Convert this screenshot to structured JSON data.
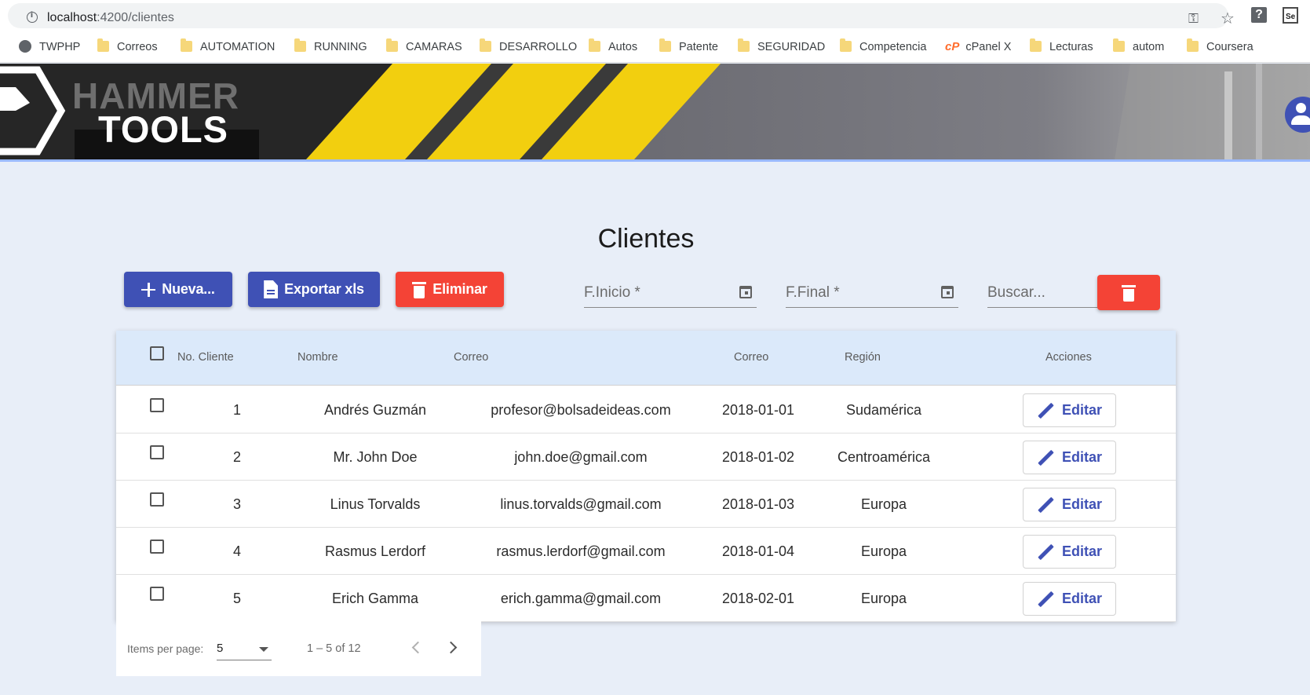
{
  "browser": {
    "url_host": "localhost",
    "url_path": ":4200/clientes",
    "bookmarks": [
      "TWPHP",
      "Correos",
      "AUTOMATION",
      "RUNNING",
      "CAMARAS",
      "DESARROLLO",
      "Autos",
      "Patente",
      "SEGURIDAD",
      "Competencia",
      "cPanel X",
      "Lecturas",
      "autom",
      "Coursera"
    ],
    "ext_help": "?",
    "ext_se": "Se"
  },
  "brand": {
    "line1": "HAMMER",
    "line2": "TOOLS"
  },
  "page": {
    "title": "Clientes"
  },
  "toolbar": {
    "new_label": "Nueva...",
    "export_label": "Exportar xls",
    "delete_label": "Eliminar",
    "fecha_inicio_placeholder": "F.Inicio *",
    "fecha_final_placeholder": "F.Final *",
    "search_placeholder": "Buscar..."
  },
  "table": {
    "headers": [
      "No. Cliente",
      "Nombre",
      "Correo",
      "Correo",
      "Región",
      "Acciones"
    ],
    "edit_label": "Editar",
    "rows": [
      [
        "1",
        "Andrés Guzmán",
        "profesor@bolsadeideas.com",
        "2018-01-01",
        "Sudamérica"
      ],
      [
        "2",
        "Mr. John Doe",
        "john.doe@gmail.com",
        "2018-01-02",
        "Centroamérica"
      ],
      [
        "3",
        "Linus Torvalds",
        "linus.torvalds@gmail.com",
        "2018-01-03",
        "Europa"
      ],
      [
        "4",
        "Rasmus Lerdorf",
        "rasmus.lerdorf@gmail.com",
        "2018-01-04",
        "Europa"
      ],
      [
        "5",
        "Erich Gamma",
        "erich.gamma@gmail.com",
        "2018-02-01",
        "Europa"
      ]
    ]
  },
  "paginator": {
    "items_label": "Items per page:",
    "page_size": "5",
    "range": "1 – 5 of 12"
  },
  "colors": {
    "primary": "#3f51b5",
    "warn": "#f44336",
    "banner_yellow": "#f2cf0f",
    "background": "#e8eef8"
  }
}
